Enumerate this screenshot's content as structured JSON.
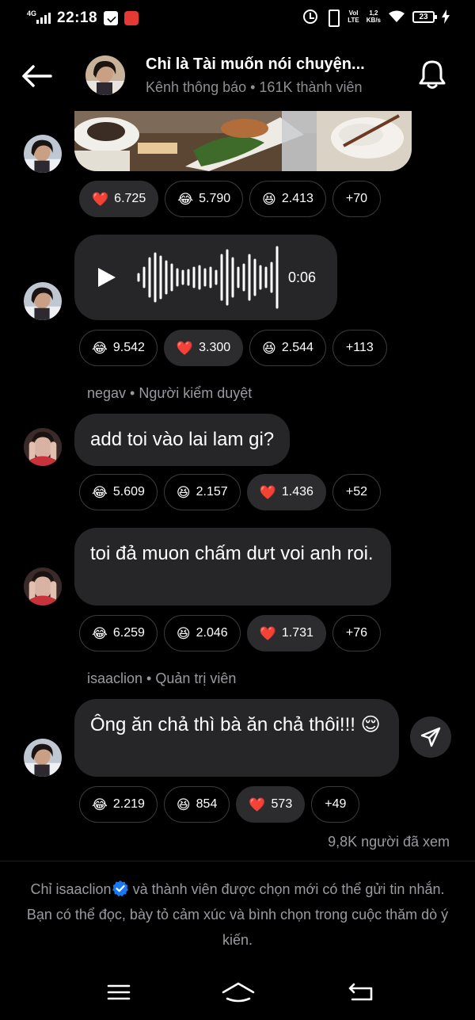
{
  "status_bar": {
    "network": "4G",
    "time": "22:18",
    "volte": "VoI\nLTE",
    "speed": "1,2\nKB/s",
    "battery": "23"
  },
  "header": {
    "title": "Chỉ là Tài muốn nói chuyện...",
    "subtitle": "Kênh thông báo • 161K thành viên"
  },
  "messages": [
    {
      "reactions": [
        {
          "emoji": "❤️",
          "count": "6.725",
          "active": true
        },
        {
          "emoji": "😂",
          "count": "5.790",
          "active": false
        },
        {
          "emoji": "😆",
          "count": "2.413",
          "active": false
        },
        {
          "more": "+70"
        }
      ]
    },
    {
      "audio_duration": "0:06",
      "reactions": [
        {
          "emoji": "😂",
          "count": "9.542",
          "active": false
        },
        {
          "emoji": "❤️",
          "count": "3.300",
          "active": true
        },
        {
          "emoji": "😆",
          "count": "2.544",
          "active": false
        },
        {
          "more": "+113"
        }
      ]
    },
    {
      "sender": "negav • Người kiểm duyệt",
      "text": "add toi vào lai lam gi?",
      "reactions": [
        {
          "emoji": "😂",
          "count": "5.609",
          "active": false
        },
        {
          "emoji": "😆",
          "count": "2.157",
          "active": false
        },
        {
          "emoji": "❤️",
          "count": "1.436",
          "active": true
        },
        {
          "more": "+52"
        }
      ]
    },
    {
      "text": "toi đả muon chấm dưt voi anh roi.",
      "reactions": [
        {
          "emoji": "😂",
          "count": "6.259",
          "active": false
        },
        {
          "emoji": "😆",
          "count": "2.046",
          "active": false
        },
        {
          "emoji": "❤️",
          "count": "1.731",
          "active": true
        },
        {
          "more": "+76"
        }
      ]
    },
    {
      "sender": "isaaclion • Quản trị viên",
      "text": "Ông ăn chả thì bà ăn chả thôi!!! 😌",
      "reactions": [
        {
          "emoji": "😂",
          "count": "2.219",
          "active": false
        },
        {
          "emoji": "😆",
          "count": "854",
          "active": false
        },
        {
          "emoji": "❤️",
          "count": "573",
          "active": true
        },
        {
          "more": "+49"
        }
      ]
    }
  ],
  "views": "9,8K người đã xem",
  "notice": {
    "prefix": "Chỉ isaaclion",
    "suffix": " và thành viên được chọn mới có thể gửi tin nhắn. Bạn có thể đọc, bày tỏ cảm xúc và bình chọn trong cuộc thăm dò ý kiến."
  },
  "colors": {
    "background": "#000000",
    "bubble": "#262628",
    "muted_text": "#9a9aa0",
    "verified": "#1877f2"
  },
  "icons": [
    "back-arrow-icon",
    "bell-icon",
    "play-icon",
    "send-icon",
    "verified-badge-icon",
    "menu-icon",
    "home-icon",
    "back-nav-icon"
  ]
}
